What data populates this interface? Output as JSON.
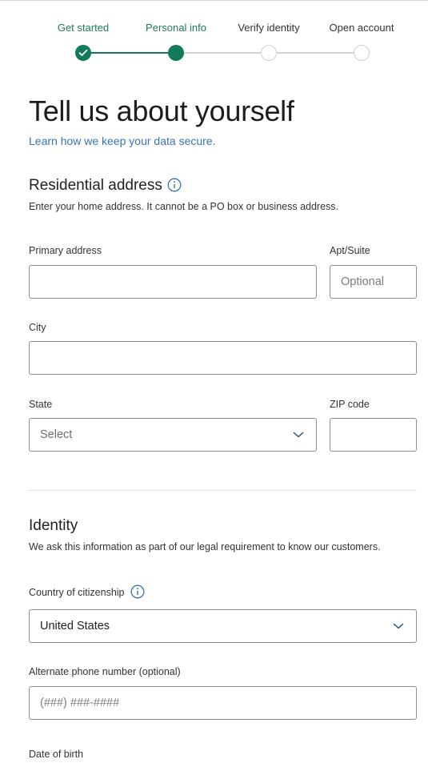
{
  "stepper": {
    "steps": [
      {
        "label": "Get started",
        "state": "complete"
      },
      {
        "label": "Personal info",
        "state": "current"
      },
      {
        "label": "Verify identity",
        "state": "upcoming"
      },
      {
        "label": "Open account",
        "state": "upcoming"
      }
    ]
  },
  "page": {
    "title": "Tell us about yourself",
    "security_link": "Learn how we keep your data secure."
  },
  "address": {
    "heading": "Residential address",
    "description": "Enter your home address. It cannot be a PO box or business address.",
    "primary_label": "Primary address",
    "primary_value": "",
    "apt_label": "Apt/Suite",
    "apt_placeholder": "Optional",
    "city_label": "City",
    "city_value": "",
    "state_label": "State",
    "state_value": "Select",
    "zip_label": "ZIP code",
    "zip_value": ""
  },
  "identity": {
    "heading": "Identity",
    "description": "We ask this information as part of our legal requirement to know our customers.",
    "country_label": "Country of citizenship",
    "country_value": "United States",
    "phone_label": "Alternate phone number (optional)",
    "phone_placeholder": "(###) ###-####",
    "dob_label": "Date of birth"
  },
  "colors": {
    "accent": "#117a5a",
    "link": "#3a73b3",
    "track_inactive": "#d4d4d4"
  }
}
